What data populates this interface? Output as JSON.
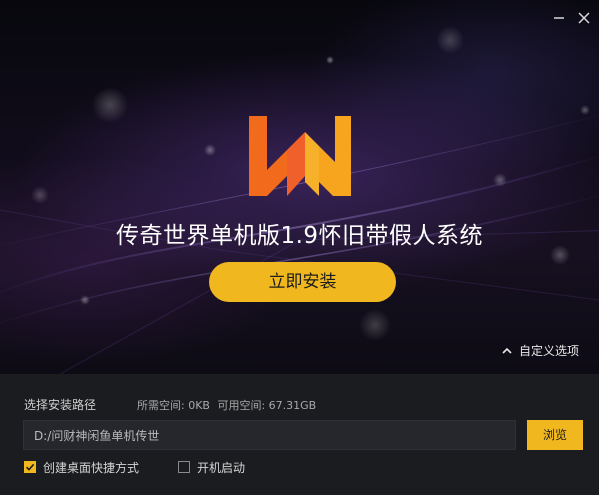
{
  "window": {
    "minimize_icon": "minimize-icon",
    "close_icon": "close-icon"
  },
  "brand": {
    "logo": "wn-logo",
    "title": "传奇世界单机版1.9怀旧带假人系统",
    "colors": {
      "accent": "#f0b81e",
      "logo_orange": "#f26a1b",
      "logo_yellow": "#f7b02a"
    }
  },
  "install_button": {
    "label": "立即安装"
  },
  "custom_options": {
    "label": "自定义选项",
    "icon": "chevron-up-icon"
  },
  "install_path": {
    "label": "选择安装路径",
    "required_space": "所需空间: 0KB",
    "available_space": "可用空间: 67.31GB",
    "value": "D:/问财神闲鱼单机传世",
    "browse_label": "浏览"
  },
  "options": {
    "desktop_shortcut": {
      "label": "创建桌面快捷方式",
      "checked": true
    },
    "autostart": {
      "label": "开机启动",
      "checked": false
    }
  }
}
